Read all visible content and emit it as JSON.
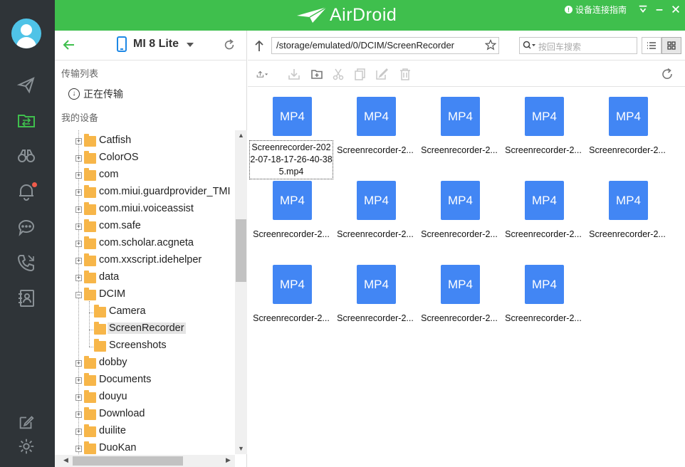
{
  "app": {
    "name": "AirDroid",
    "guide_label": "设备连接指南",
    "brand_color": "#3fbf4d",
    "file_icon_color": "#4286f4",
    "folder_color": "#f7b649"
  },
  "rail": {
    "items": [
      {
        "name": "send-icon",
        "label": ""
      },
      {
        "name": "file-transfer-icon",
        "label": ""
      },
      {
        "name": "binoculars-icon",
        "label": ""
      },
      {
        "name": "bell-icon",
        "label": ""
      },
      {
        "name": "chat-icon",
        "label": ""
      },
      {
        "name": "phone-call-icon",
        "label": ""
      },
      {
        "name": "contacts-icon",
        "label": ""
      },
      {
        "name": "edit-icon",
        "label": ""
      },
      {
        "name": "settings-icon",
        "label": ""
      }
    ]
  },
  "device": {
    "name": "MI 8 Lite"
  },
  "sidebar": {
    "transfer_list_label": "传输列表",
    "transferring_label": "正在传输",
    "my_devices_label": "我的设备"
  },
  "tree": [
    {
      "label": "Catfish",
      "level": 1
    },
    {
      "label": "ColorOS",
      "level": 1
    },
    {
      "label": "com",
      "level": 1
    },
    {
      "label": "com.miui.guardprovider_TMI",
      "level": 1
    },
    {
      "label": "com.miui.voiceassist",
      "level": 1
    },
    {
      "label": "com.safe",
      "level": 1
    },
    {
      "label": "com.scholar.acgneta",
      "level": 1
    },
    {
      "label": "com.xxscript.idehelper",
      "level": 1
    },
    {
      "label": "data",
      "level": 1
    },
    {
      "label": "DCIM",
      "level": 1,
      "expanded": true
    },
    {
      "label": "Camera",
      "level": 2
    },
    {
      "label": "ScreenRecorder",
      "level": 2,
      "selected": true
    },
    {
      "label": "Screenshots",
      "level": 2
    },
    {
      "label": "dobby",
      "level": 1
    },
    {
      "label": "Documents",
      "level": 1
    },
    {
      "label": "douyu",
      "level": 1
    },
    {
      "label": "Download",
      "level": 1
    },
    {
      "label": "duilite",
      "level": 1
    },
    {
      "label": "DuoKan",
      "level": 1
    }
  ],
  "path": {
    "value": "/storage/emulated/0/DCIM/ScreenRecorder"
  },
  "search": {
    "placeholder": "按回车搜索"
  },
  "files": [
    {
      "type": "MP4",
      "name": "Screenrecorder-2022-07-18-17-26-40-385.mp4",
      "focused": true
    },
    {
      "type": "MP4",
      "name": "Screenrecorder-2..."
    },
    {
      "type": "MP4",
      "name": "Screenrecorder-2..."
    },
    {
      "type": "MP4",
      "name": "Screenrecorder-2..."
    },
    {
      "type": "MP4",
      "name": "Screenrecorder-2..."
    },
    {
      "type": "MP4",
      "name": "Screenrecorder-2..."
    },
    {
      "type": "MP4",
      "name": "Screenrecorder-2..."
    },
    {
      "type": "MP4",
      "name": "Screenrecorder-2..."
    },
    {
      "type": "MP4",
      "name": "Screenrecorder-2..."
    },
    {
      "type": "MP4",
      "name": "Screenrecorder-2..."
    },
    {
      "type": "MP4",
      "name": "Screenrecorder-2..."
    },
    {
      "type": "MP4",
      "name": "Screenrecorder-2..."
    },
    {
      "type": "MP4",
      "name": "Screenrecorder-2..."
    },
    {
      "type": "MP4",
      "name": "Screenrecorder-2..."
    }
  ]
}
